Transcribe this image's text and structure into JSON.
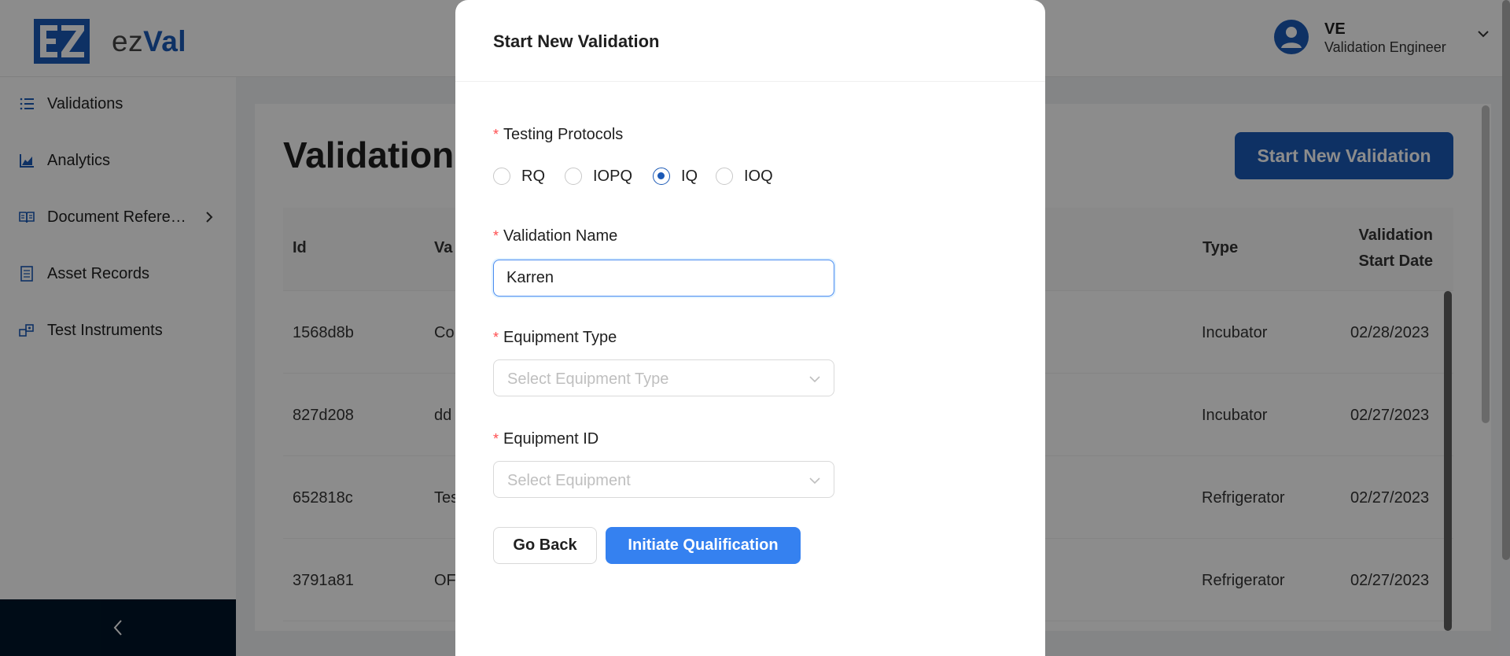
{
  "app": {
    "logo_mark": "EZ",
    "logo_prefix": "ez",
    "logo_accent": "Val",
    "brand_color": "#1b59b6"
  },
  "user": {
    "initials": "VE",
    "role": "Validation Engineer"
  },
  "sidebar": {
    "items": [
      {
        "label": "Validations",
        "icon": "list-icon"
      },
      {
        "label": "Analytics",
        "icon": "area-chart-icon"
      },
      {
        "label": "Document Refere…",
        "icon": "book-icon"
      },
      {
        "label": "Asset Records",
        "icon": "file-text-icon"
      },
      {
        "label": "Test Instruments",
        "icon": "instrument-icon"
      }
    ]
  },
  "main": {
    "title": "Validation",
    "start_button": "Start New Validation",
    "table": {
      "columns": [
        "Id",
        "Va",
        "Type",
        "Validation",
        "Start Date"
      ],
      "rows": [
        {
          "id": "1568d8b",
          "name": "Co",
          "type": "Incubator",
          "date": "02/28/2023"
        },
        {
          "id": "827d208",
          "name": "dd",
          "type": "Incubator",
          "date": "02/27/2023"
        },
        {
          "id": "652818c",
          "name": "Tes",
          "type": "Refrigerator",
          "date": "02/27/2023"
        },
        {
          "id": "3791a81",
          "name": "OF",
          "type": "Refrigerator",
          "date": "02/27/2023"
        }
      ]
    }
  },
  "modal": {
    "title": "Start New Validation",
    "protocols_label": "Testing Protocols",
    "protocols": [
      {
        "label": "RQ",
        "checked": false
      },
      {
        "label": "IOPQ",
        "checked": false
      },
      {
        "label": "IQ",
        "checked": true
      },
      {
        "label": "IOQ",
        "checked": false
      }
    ],
    "name_label": "Validation Name",
    "name_value": "Karren",
    "equip_type_label": "Equipment Type",
    "equip_type_placeholder": "Select Equipment Type",
    "equip_id_label": "Equipment ID",
    "equip_id_placeholder": "Select Equipment",
    "back_button": "Go Back",
    "submit_button": "Initiate Qualification",
    "required_mark": "*"
  }
}
